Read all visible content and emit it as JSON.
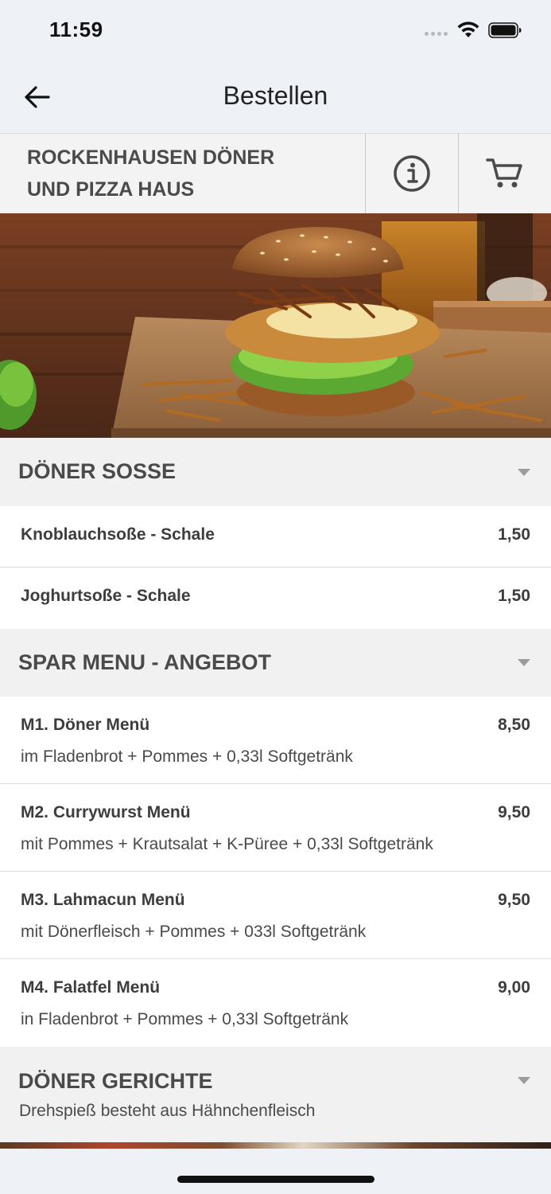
{
  "status_bar": {
    "time": "11:59"
  },
  "nav": {
    "title": "Bestellen"
  },
  "restaurant": {
    "name_line1": "ROCKENHAUSEN DÖNER",
    "name_line2": "UND PIZZA HAUS"
  },
  "menu": {
    "categories": [
      {
        "title": "DÖNER SOSSE",
        "items": [
          {
            "name": "Knoblauchsoße - Schale",
            "price": "1,50"
          },
          {
            "name": "Joghurtsoße - Schale",
            "price": "1,50"
          }
        ]
      },
      {
        "title": "SPAR MENU - ANGEBOT",
        "items": [
          {
            "name": "M1. Döner Menü",
            "price": "8,50",
            "description": "im Fladenbrot + Pommes + 0,33l Softgetränk"
          },
          {
            "name": "M2. Currywurst Menü",
            "price": "9,50",
            "description": "mit Pommes + Krautsalat + K-Püree + 0,33l Softgetränk"
          },
          {
            "name": "M3. Lahmacun Menü",
            "price": "9,50",
            "description": "mit Dönerfleisch + Pommes + 033l Softgetränk"
          },
          {
            "name": "M4. Falatfel Menü",
            "price": "9,00",
            "description": "in Fladenbrot + Pommes + 0,33l Softgetränk"
          }
        ]
      },
      {
        "title": "DÖNER GERICHTE",
        "subtitle": "Drehspieß besteht aus Hähnchenfleisch"
      }
    ]
  },
  "icons": {
    "back": "arrow-left-icon",
    "info": "info-icon",
    "cart": "cart-icon",
    "chevron": "chevron-down-icon"
  },
  "colors": {
    "background": "#eef1f6",
    "category_bg": "#f1f1f1",
    "text": "#3d3d3d"
  }
}
